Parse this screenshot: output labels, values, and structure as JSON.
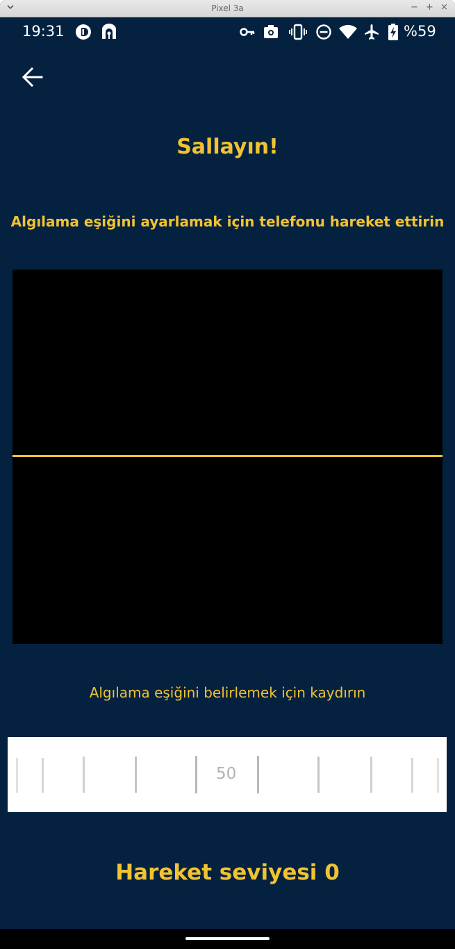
{
  "window": {
    "title": "Pixel 3a",
    "minimize": "−",
    "maximize": "+",
    "close": "×"
  },
  "status_bar": {
    "time": "19:31",
    "battery": "%59",
    "icons": [
      "data-saver-icon",
      "hotspot-icon",
      "vpn-key-icon",
      "screenshot-icon",
      "vibrate-icon",
      "do-not-disturb-icon",
      "wifi-icon",
      "airplane-mode-icon",
      "battery-charging-icon"
    ]
  },
  "screen": {
    "title": "Sallayın!",
    "subtitle": "Algılama eşiğini ayarlamak için telefonu hareket ettirin",
    "slider_hint": "Algılama eşiğini belirlemek için kaydırın",
    "threshold_value": "50",
    "motion_level": "Hareket seviyesi 0"
  },
  "colors": {
    "background": "#042240",
    "accent": "#f2c233",
    "graph": "#000000"
  }
}
